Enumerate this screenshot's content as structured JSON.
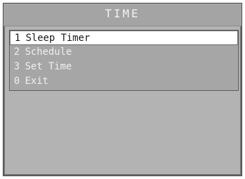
{
  "screen": {
    "title": "TIME"
  },
  "menu": {
    "items": [
      {
        "number": "1",
        "label": "Sleep Timer",
        "selected": true
      },
      {
        "number": "2",
        "label": "Schedule",
        "selected": false
      },
      {
        "number": "3",
        "label": "Set Time",
        "selected": false
      },
      {
        "number": "0",
        "label": "Exit",
        "selected": false
      }
    ]
  },
  "colors": {
    "background": "#b3b3b3",
    "title_bar": "#a4a4a4",
    "menu_panel": "#a6a6a6",
    "highlight": "#ffffff",
    "text": "#f0f0f0",
    "highlight_text": "#1a1a1a"
  }
}
